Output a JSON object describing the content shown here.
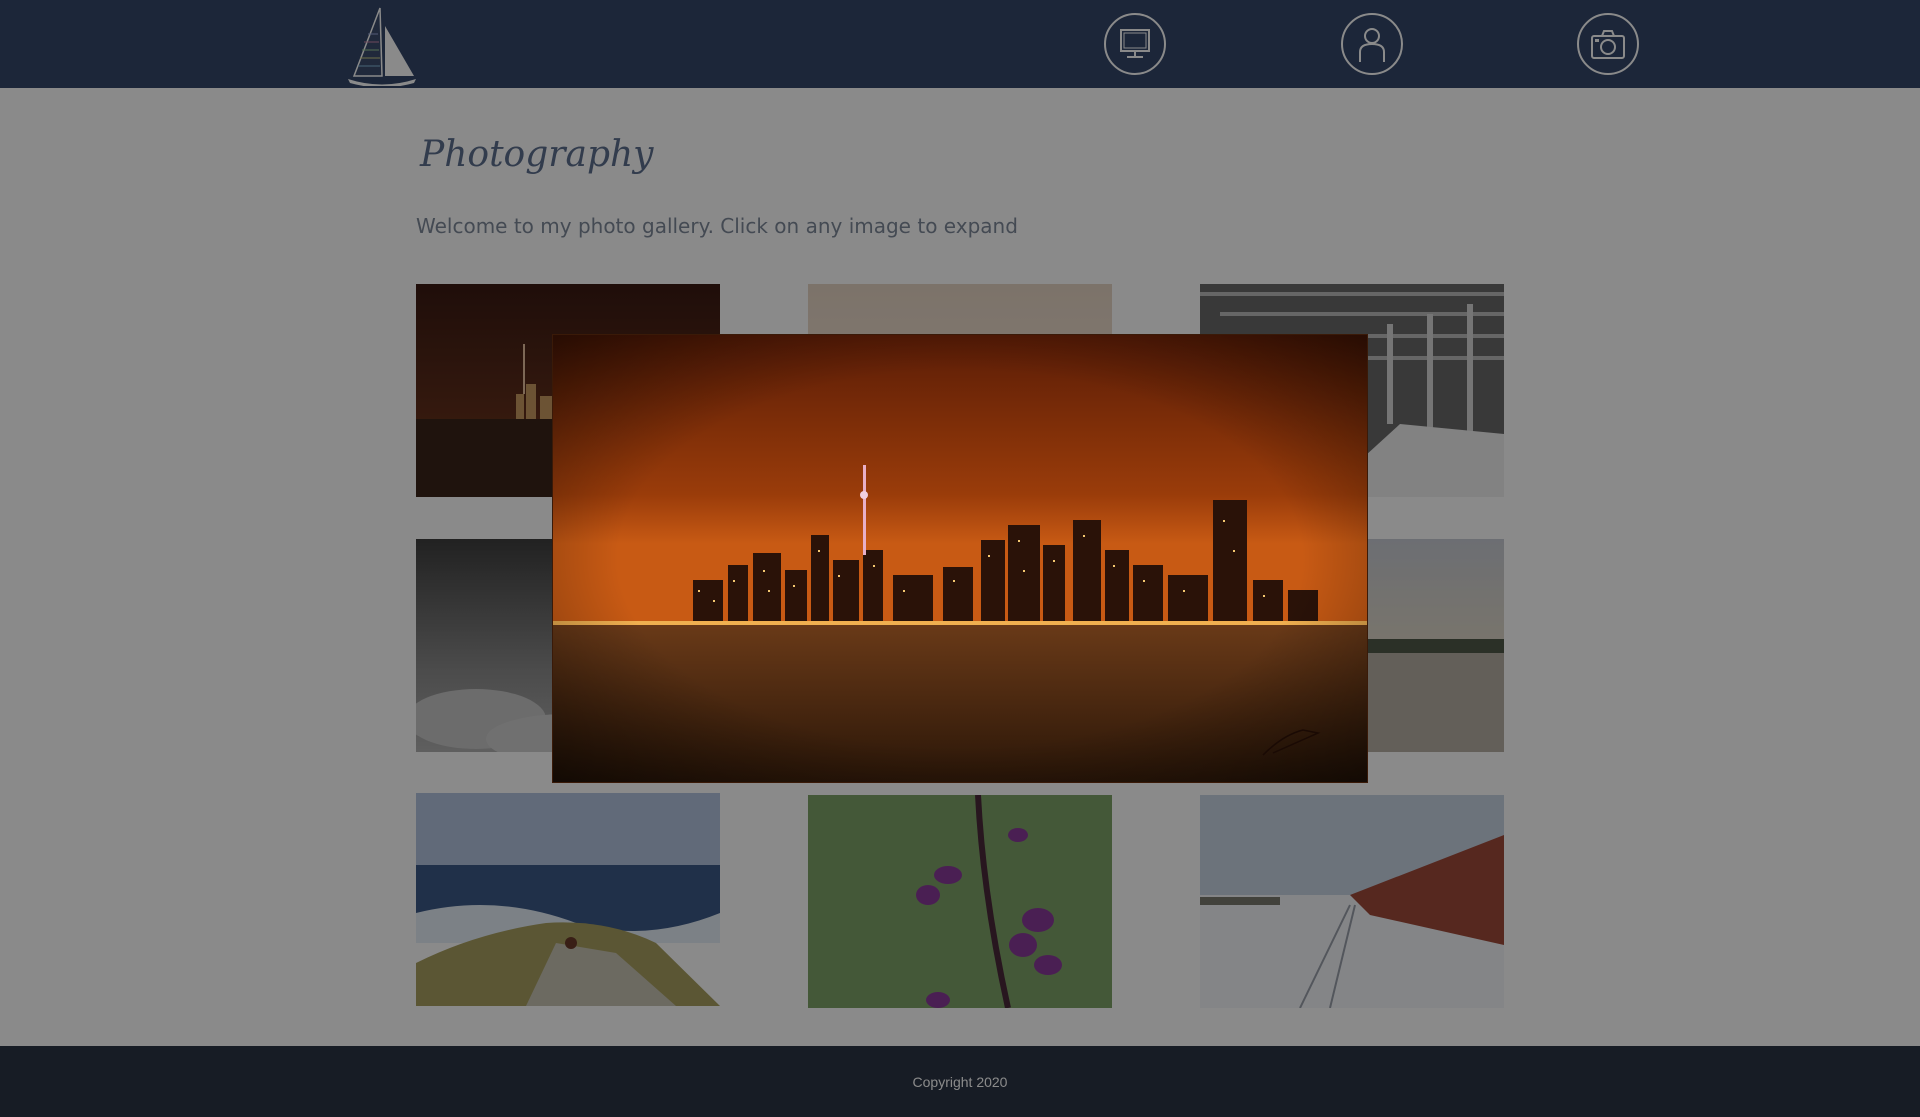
{
  "header": {
    "logo_icon": "sailboat-logo",
    "nav": [
      {
        "icon": "computer-icon"
      },
      {
        "icon": "person-icon"
      },
      {
        "icon": "camera-icon"
      }
    ],
    "background": "#34476a"
  },
  "main": {
    "title": "Photography",
    "intro": "Welcome to my photo gallery. Click on any image to expand",
    "gallery": [
      {
        "icon": "city-skyline-night-photo"
      },
      {
        "icon": "sunset-photo"
      },
      {
        "icon": "covered-bridge-photo"
      },
      {
        "icon": "stormy-shore-photo"
      },
      {
        "icon": "forest-photo"
      },
      {
        "icon": "lake-trees-photo"
      },
      {
        "icon": "ocean-rocks-photo"
      },
      {
        "icon": "fireweed-flower-photo"
      },
      {
        "icon": "snowy-train-photo"
      }
    ]
  },
  "modal": {
    "icon": "city-skyline-night-photo",
    "overlay_color": "rgba(0,0,0,0.46)"
  },
  "footer": {
    "copyright": "Copyright 2020",
    "background": "#2b3445"
  }
}
